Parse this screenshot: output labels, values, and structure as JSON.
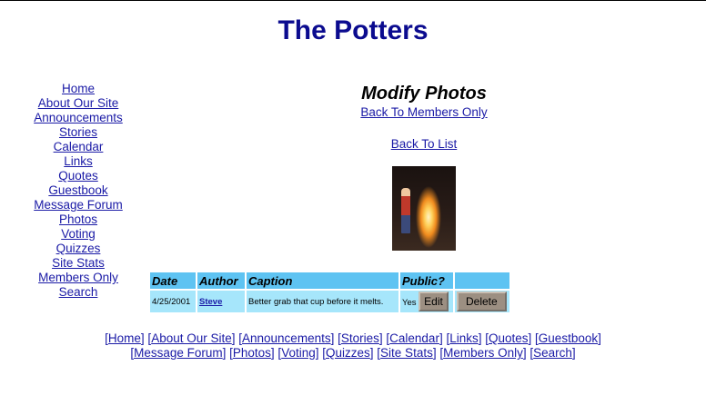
{
  "site_title": "The Potters",
  "sidebar": {
    "items": [
      "Home",
      "About Our Site",
      "Announcements",
      "Stories",
      "Calendar",
      "Links",
      "Quotes",
      "Guestbook",
      "Message Forum",
      "Photos",
      "Voting",
      "Quizzes",
      "Site Stats",
      "Members Only",
      "Search"
    ]
  },
  "main": {
    "heading": "Modify Photos",
    "back_members": "Back To Members Only",
    "back_list": "Back To List"
  },
  "table": {
    "headers": [
      "Date",
      "Author",
      "Caption",
      "Public?",
      ""
    ],
    "rows": [
      {
        "date": "4/25/2001",
        "author": "Steve",
        "caption": "Better grab that cup before it melts.",
        "public": "Yes",
        "edit": "Edit",
        "delete": "Delete"
      }
    ]
  },
  "footer": {
    "line1": [
      "Home",
      "About Our Site",
      "Announcements",
      "Stories",
      "Calendar",
      "Links",
      "Quotes",
      "Guestbook"
    ],
    "line2": [
      "Message Forum",
      "Photos",
      "Voting",
      "Quizzes",
      "Site Stats",
      "Members Only",
      "Search"
    ]
  }
}
